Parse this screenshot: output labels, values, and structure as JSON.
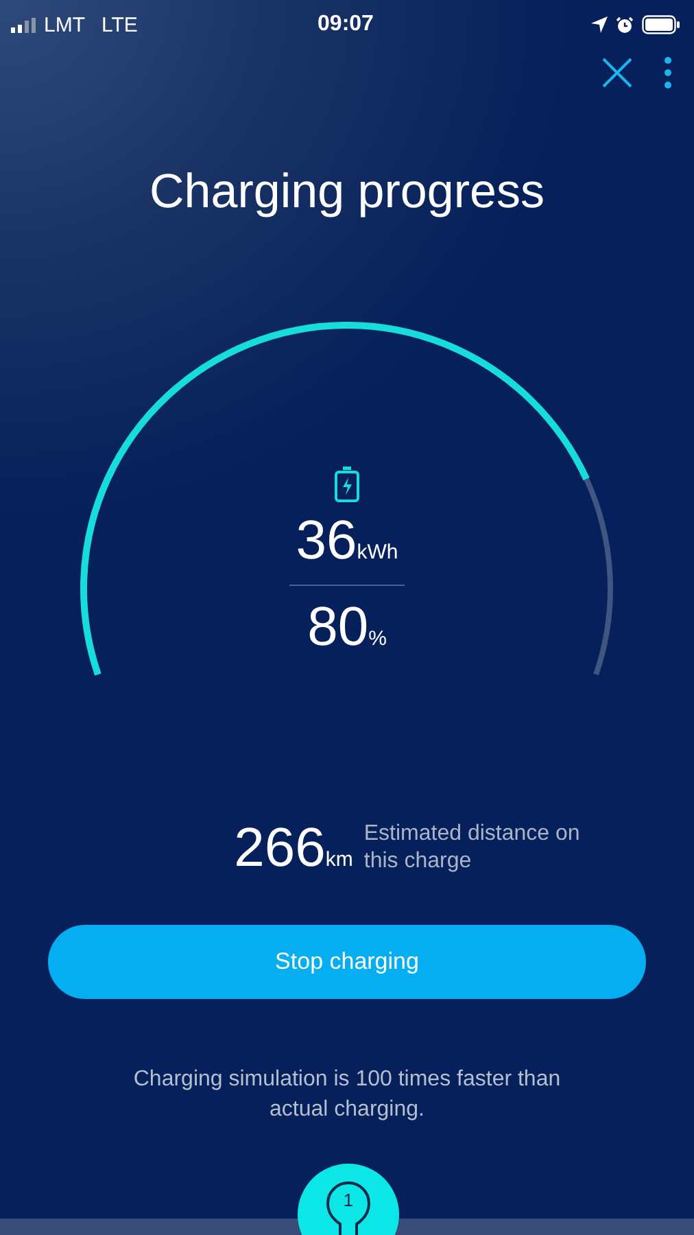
{
  "status_bar": {
    "carrier": "LMT",
    "network": "LTE",
    "time": "09:07"
  },
  "title": "Charging progress",
  "gauge": {
    "energy": "36",
    "energy_unit": "kWh",
    "percent": "80",
    "percent_unit": "%"
  },
  "range": {
    "value": "266",
    "unit": "km",
    "label": "Estimated distance on this charge"
  },
  "stop_button": "Stop charging",
  "note": "Charging simulation is 100 times faster than actual charging.",
  "tip": {
    "number": "1"
  }
}
